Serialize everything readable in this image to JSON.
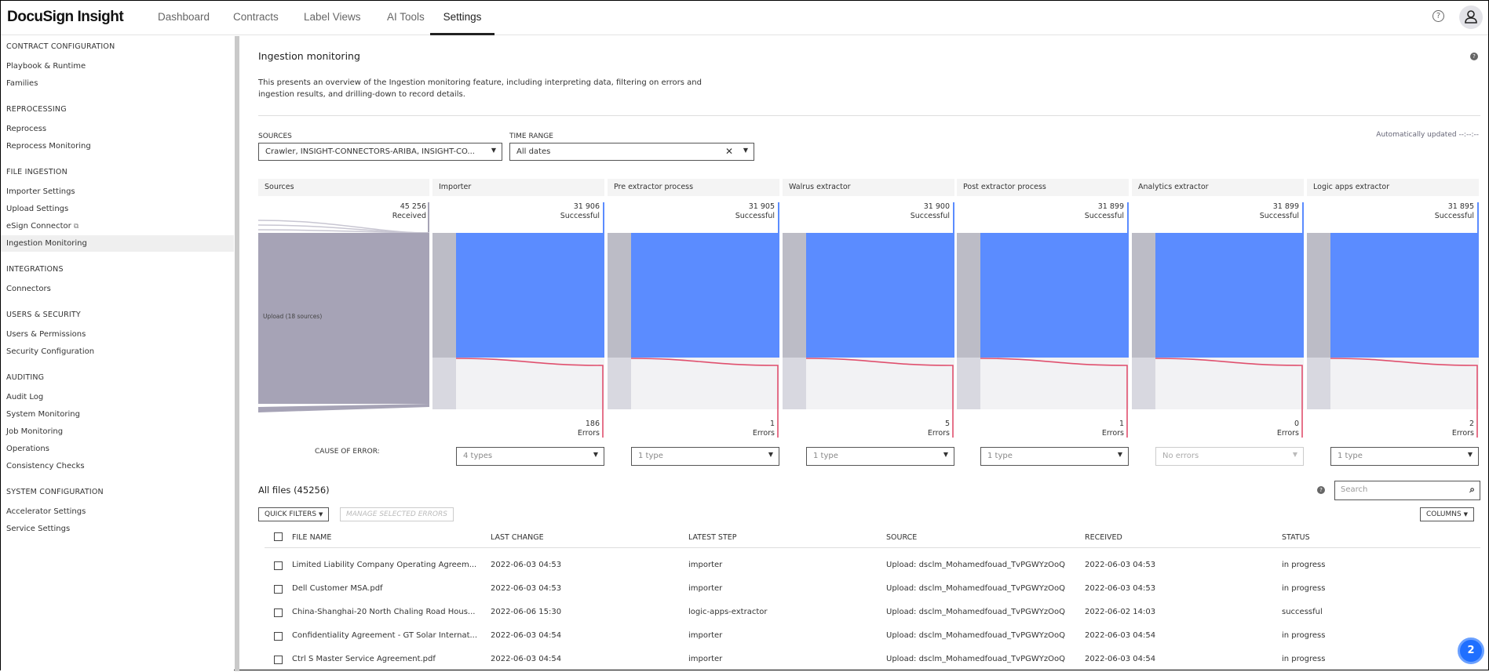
{
  "app": {
    "logo": "DocuSign Insight",
    "tabs": [
      "Dashboard",
      "Contracts",
      "Label Views",
      "AI Tools",
      "Settings"
    ],
    "active_tab": "Settings",
    "help": "?"
  },
  "sidebar": {
    "sections": [
      {
        "title": "CONTRACT CONFIGURATION",
        "items": [
          "Playbook & Runtime",
          "Families"
        ]
      },
      {
        "title": "REPROCESSING",
        "items": [
          "Reprocess",
          "Reprocess Monitoring"
        ]
      },
      {
        "title": "FILE INGESTION",
        "items": [
          "Importer Settings",
          "Upload Settings",
          "eSign Connector",
          "Ingestion Monitoring"
        ]
      },
      {
        "title": "INTEGRATIONS",
        "items": [
          "Connectors"
        ]
      },
      {
        "title": "USERS & SECURITY",
        "items": [
          "Users & Permissions",
          "Security Configuration"
        ]
      },
      {
        "title": "AUDITING",
        "items": [
          "Audit Log",
          "System Monitoring",
          "Job Monitoring",
          "Operations",
          "Consistency Checks"
        ]
      },
      {
        "title": "SYSTEM CONFIGURATION",
        "items": [
          "Accelerator Settings",
          "Service Settings"
        ]
      }
    ],
    "active_item": "Ingestion Monitoring"
  },
  "page": {
    "title": "Ingestion monitoring",
    "description_line1": "This presents an overview of the Ingestion monitoring feature, including interpreting data, filtering on errors and",
    "description_line2": "ingestion results, and drilling-down to record details.",
    "auto_updated": "Automatically updated --:--:--"
  },
  "filters": {
    "sources_label": "SOURCES",
    "sources_value": "Crawler, INSIGHT-CONNECTORS-ARIBA, INSIGHT-CO...",
    "time_label": "TIME RANGE",
    "time_value": "All dates"
  },
  "colors": {
    "success": "#5b8cff",
    "error": "#e0506e",
    "source": "#a6a3b6",
    "pass": "#bcbcc6"
  },
  "pipeline": {
    "sources": {
      "title": "Sources",
      "count": "45 256",
      "count_label": "Received",
      "total": 45256,
      "upload_label": "Upload (18 sources)"
    },
    "stages": [
      {
        "title": "Importer",
        "success": "31 906",
        "success_value": 31906,
        "errors": "186",
        "error_filter": "4 types"
      },
      {
        "title": "Pre extractor process",
        "success": "31 905",
        "success_value": 31905,
        "errors": "1",
        "error_filter": "1 type"
      },
      {
        "title": "Walrus extractor",
        "success": "31 900",
        "success_value": 31900,
        "errors": "5",
        "error_filter": "1 type"
      },
      {
        "title": "Post extractor process",
        "success": "31 899",
        "success_value": 31899,
        "errors": "1",
        "error_filter": "1 type"
      },
      {
        "title": "Analytics extractor",
        "success": "31 899",
        "success_value": 31899,
        "errors": "0",
        "error_filter": "No errors"
      },
      {
        "title": "Logic apps extractor",
        "success": "31 895",
        "success_value": 31895,
        "errors": "2",
        "error_filter": "1 type"
      }
    ],
    "success_label": "Successful",
    "errors_label": "Errors",
    "cause_label": "CAUSE OF ERROR:"
  },
  "files": {
    "title": "All files (45256)",
    "quick_filters": "QUICK FILTERS",
    "manage": "MANAGE SELECTED ERRORS",
    "columns_btn": "COLUMNS",
    "search_placeholder": "Search",
    "headers": [
      "FILE NAME",
      "LAST CHANGE",
      "LATEST STEP",
      "SOURCE",
      "RECEIVED",
      "STATUS"
    ],
    "rows": [
      [
        "Limited Liability Company Operating Agreem...",
        "2022-06-03 04:53",
        "importer",
        "Upload: dsclm_Mohamedfouad_TvPGWYzOoQ",
        "2022-06-03 04:53",
        "in progress"
      ],
      [
        "Dell Customer MSA.pdf",
        "2022-06-03 04:53",
        "importer",
        "Upload: dsclm_Mohamedfouad_TvPGWYzOoQ",
        "2022-06-03 04:53",
        "in progress"
      ],
      [
        "China-Shanghai-20 North Chaling Road Hous...",
        "2022-06-06 15:30",
        "logic-apps-extractor",
        "Upload: dsclm_Mohamedfouad_TvPGWYzOoQ",
        "2022-06-02 14:03",
        "successful"
      ],
      [
        "Confidentiality Agreement - GT Solar Internat...",
        "2022-06-03 04:54",
        "importer",
        "Upload: dsclm_Mohamedfouad_TvPGWYzOoQ",
        "2022-06-03 04:54",
        "in progress"
      ],
      [
        "Ctrl S Master Service Agreement.pdf",
        "2022-06-03 04:54",
        "importer",
        "Upload: dsclm_Mohamedfouad_TvPGWYzOoQ",
        "2022-06-03 04:54",
        "in progress"
      ]
    ]
  },
  "chat_badge": "2"
}
